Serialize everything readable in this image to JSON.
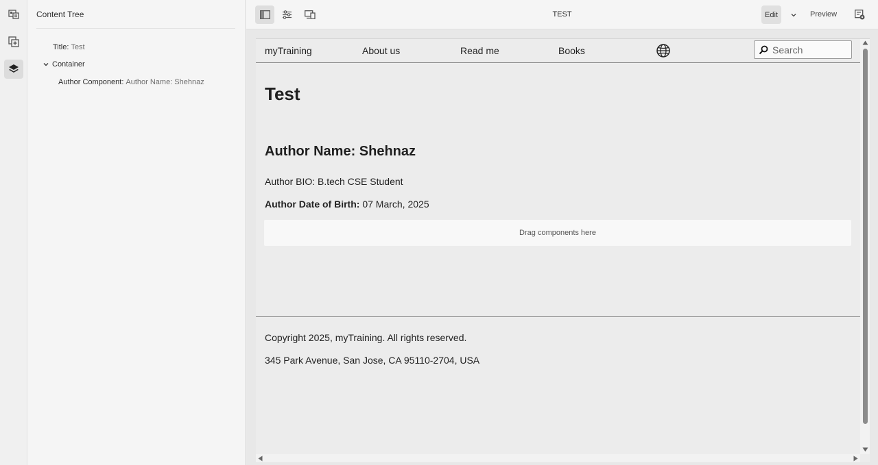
{
  "colors": {
    "rail_bg": "#f0f0f0",
    "panel_bg": "#f5f5f5",
    "canvas_bg": "#ececec",
    "active_btn": "#dcdcdc",
    "text": "#2c2c2c",
    "muted_text": "#6e6e6e"
  },
  "rail": {
    "items": [
      {
        "name": "page-properties-icon",
        "active": false
      },
      {
        "name": "components-icon",
        "active": false
      },
      {
        "name": "layers-icon",
        "active": true
      }
    ]
  },
  "panel": {
    "title": "Content Tree",
    "tree": {
      "title_label": "Title:",
      "title_value": "Test",
      "container_label": "Container",
      "author_label": "Author Component:",
      "author_value": "Author Name: Shehnaz"
    }
  },
  "toolbar": {
    "page_name": "TEST",
    "edit_label": "Edit",
    "preview_label": "Preview",
    "icons": [
      "side-panel-icon",
      "properties-icon",
      "emulator-icon",
      "chevron-down-icon",
      "page-info-icon"
    ]
  },
  "site": {
    "brand": "myTraining",
    "nav": [
      "About us",
      "Read me",
      "Books"
    ],
    "search_placeholder": "Search",
    "page_title": "Test",
    "author_name": "Author Name: Shehnaz",
    "author_bio": "Author BIO: B.tech CSE Student",
    "dob_label": "Author Date of Birth:",
    "dob_value": "07 March, 2025",
    "dropzone": "Drag components here",
    "footer_copyright": "Copyright 2025, myTraining. All rights reserved.",
    "footer_address": "345 Park Avenue, San Jose, CA 95110-2704, USA"
  }
}
